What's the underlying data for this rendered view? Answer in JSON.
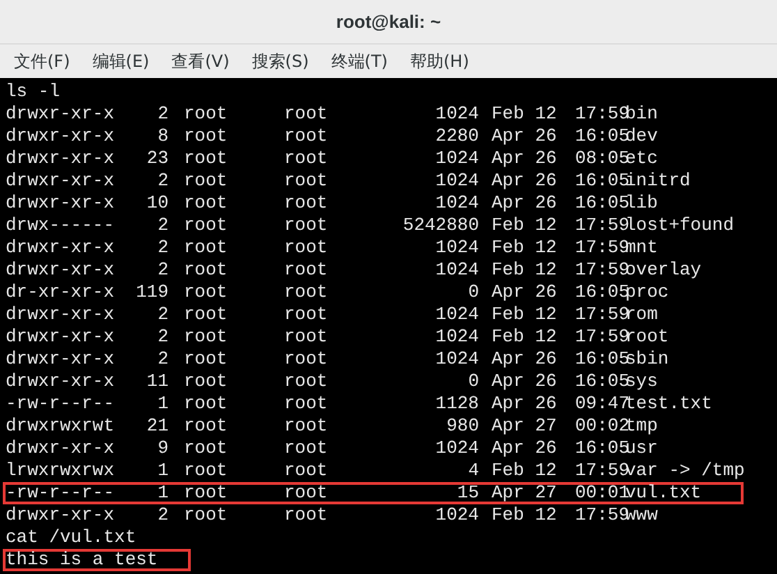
{
  "window": {
    "title": "root@kali: ~"
  },
  "menu": [
    {
      "label": "文件(F)"
    },
    {
      "label": "编辑(E)"
    },
    {
      "label": "查看(V)"
    },
    {
      "label": "搜索(S)"
    },
    {
      "label": "终端(T)"
    },
    {
      "label": "帮助(H)"
    }
  ],
  "terminal": {
    "lines": [
      {
        "kind": "command",
        "text": "ls -l",
        "highlighted": false
      },
      {
        "kind": "entry",
        "permissions": "drwxr-xr-x",
        "links": "2",
        "owner": "root",
        "group": "root",
        "size": "1024",
        "date": "Feb 12",
        "time": "17:59",
        "name": "bin",
        "highlighted": false
      },
      {
        "kind": "entry",
        "permissions": "drwxr-xr-x",
        "links": "8",
        "owner": "root",
        "group": "root",
        "size": "2280",
        "date": "Apr 26",
        "time": "16:05",
        "name": "dev",
        "highlighted": false
      },
      {
        "kind": "entry",
        "permissions": "drwxr-xr-x",
        "links": "23",
        "owner": "root",
        "group": "root",
        "size": "1024",
        "date": "Apr 26",
        "time": "08:05",
        "name": "etc",
        "highlighted": false
      },
      {
        "kind": "entry",
        "permissions": "drwxr-xr-x",
        "links": "2",
        "owner": "root",
        "group": "root",
        "size": "1024",
        "date": "Apr 26",
        "time": "16:05",
        "name": "initrd",
        "highlighted": false
      },
      {
        "kind": "entry",
        "permissions": "drwxr-xr-x",
        "links": "10",
        "owner": "root",
        "group": "root",
        "size": "1024",
        "date": "Apr 26",
        "time": "16:05",
        "name": "lib",
        "highlighted": false
      },
      {
        "kind": "entry",
        "permissions": "drwx------",
        "links": "2",
        "owner": "root",
        "group": "root",
        "size": "5242880",
        "date": "Feb 12",
        "time": "17:59",
        "name": "lost+found",
        "highlighted": false
      },
      {
        "kind": "entry",
        "permissions": "drwxr-xr-x",
        "links": "2",
        "owner": "root",
        "group": "root",
        "size": "1024",
        "date": "Feb 12",
        "time": "17:59",
        "name": "mnt",
        "highlighted": false
      },
      {
        "kind": "entry",
        "permissions": "drwxr-xr-x",
        "links": "2",
        "owner": "root",
        "group": "root",
        "size": "1024",
        "date": "Feb 12",
        "time": "17:59",
        "name": "overlay",
        "highlighted": false
      },
      {
        "kind": "entry",
        "permissions": "dr-xr-xr-x",
        "links": "119",
        "owner": "root",
        "group": "root",
        "size": "0",
        "date": "Apr 26",
        "time": "16:05",
        "name": "proc",
        "highlighted": false
      },
      {
        "kind": "entry",
        "permissions": "drwxr-xr-x",
        "links": "2",
        "owner": "root",
        "group": "root",
        "size": "1024",
        "date": "Feb 12",
        "time": "17:59",
        "name": "rom",
        "highlighted": false
      },
      {
        "kind": "entry",
        "permissions": "drwxr-xr-x",
        "links": "2",
        "owner": "root",
        "group": "root",
        "size": "1024",
        "date": "Feb 12",
        "time": "17:59",
        "name": "root",
        "highlighted": false
      },
      {
        "kind": "entry",
        "permissions": "drwxr-xr-x",
        "links": "2",
        "owner": "root",
        "group": "root",
        "size": "1024",
        "date": "Apr 26",
        "time": "16:05",
        "name": "sbin",
        "highlighted": false
      },
      {
        "kind": "entry",
        "permissions": "drwxr-xr-x",
        "links": "11",
        "owner": "root",
        "group": "root",
        "size": "0",
        "date": "Apr 26",
        "time": "16:05",
        "name": "sys",
        "highlighted": false
      },
      {
        "kind": "entry",
        "permissions": "-rw-r--r--",
        "links": "1",
        "owner": "root",
        "group": "root",
        "size": "1128",
        "date": "Apr 26",
        "time": "09:47",
        "name": "test.txt",
        "highlighted": false
      },
      {
        "kind": "entry",
        "permissions": "drwxrwxrwt",
        "links": "21",
        "owner": "root",
        "group": "root",
        "size": "980",
        "date": "Apr 27",
        "time": "00:02",
        "name": "tmp",
        "highlighted": false
      },
      {
        "kind": "entry",
        "permissions": "drwxr-xr-x",
        "links": "9",
        "owner": "root",
        "group": "root",
        "size": "1024",
        "date": "Apr 26",
        "time": "16:05",
        "name": "usr",
        "highlighted": false
      },
      {
        "kind": "entry",
        "permissions": "lrwxrwxrwx",
        "links": "1",
        "owner": "root",
        "group": "root",
        "size": "4",
        "date": "Feb 12",
        "time": "17:59",
        "name": "var -> /tmp",
        "highlighted": false
      },
      {
        "kind": "entry",
        "permissions": "-rw-r--r--",
        "links": "1",
        "owner": "root",
        "group": "root",
        "size": "15",
        "date": "Apr 27",
        "time": "00:01",
        "name": "vul.txt",
        "highlighted": true
      },
      {
        "kind": "entry",
        "permissions": "drwxr-xr-x",
        "links": "2",
        "owner": "root",
        "group": "root",
        "size": "1024",
        "date": "Feb 12",
        "time": "17:59",
        "name": "www",
        "highlighted": false
      },
      {
        "kind": "command",
        "text": "cat /vul.txt",
        "highlighted": false
      },
      {
        "kind": "output",
        "text": "this is a test",
        "highlighted": true
      }
    ]
  }
}
